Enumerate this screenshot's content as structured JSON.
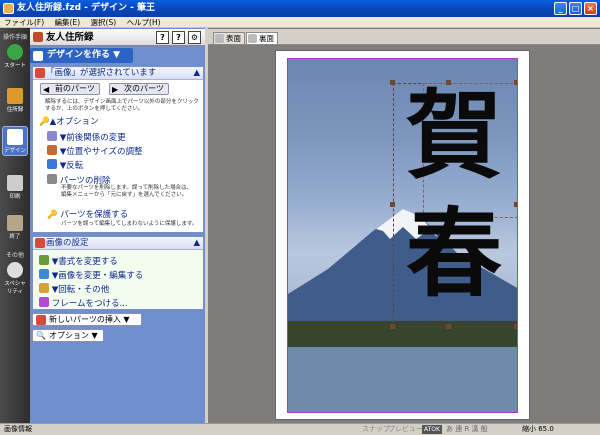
{
  "window": {
    "title": "友人住所録.fzd - デザイン - 筆王"
  },
  "menu": [
    "ファイル(F)",
    "編集(E)",
    "選択(S)",
    "ヘルプ(H)"
  ],
  "toolcol": {
    "head1": "操作手順",
    "head2": "その他",
    "buttons": [
      {
        "label": "スタート",
        "icon": "start-icon"
      },
      {
        "label": "住所録",
        "icon": "address-book-icon"
      },
      {
        "label": "デザイン",
        "icon": "design-icon"
      },
      {
        "label": "印刷",
        "icon": "printer-icon"
      },
      {
        "label": "終了",
        "icon": "exit-icon"
      },
      {
        "label": "スペシャリティ",
        "icon": "special-icon"
      }
    ]
  },
  "panel": {
    "title": "友人住所録",
    "design_button": "デザインを作る",
    "selected_header": "「画像」が選択されています",
    "prev_part": "前のパーツ",
    "next_part": "次のパーツ",
    "selected_desc": "解除するには、デザイン画面上でパーツ以外の部分をクリックするか、上のボタンを押してください。",
    "option_label": "オプション",
    "options": [
      "前後関係の変更",
      "位置やサイズの調整",
      "反転"
    ],
    "delete_label": "パーツの削除",
    "delete_desc": "不要なパーツを削除します。誤って削除した場合は、編集メニューから「元に戻す」を選んでください。",
    "protect_label": "パーツを保護する",
    "protect_desc": "パーツを誤って編集してしまわないように保護します。",
    "image_settings": "画像の設定",
    "image_items": [
      "書式を変更する",
      "画像を変更・編集する",
      "回転・その他",
      "フレームをつける..."
    ],
    "insert_button": "新しいパーツの挿入",
    "option_button": "オプション"
  },
  "tabs": [
    "表面",
    "裏面"
  ],
  "artwork": {
    "char1": "賀",
    "char2": "春"
  },
  "status": {
    "left": "画像情報",
    "snap": "スナップ",
    "preview": "プレビュー",
    "atok": "ATOK",
    "mode": "あ 連 R 漢 般",
    "zoom": "縮小 65.0"
  }
}
